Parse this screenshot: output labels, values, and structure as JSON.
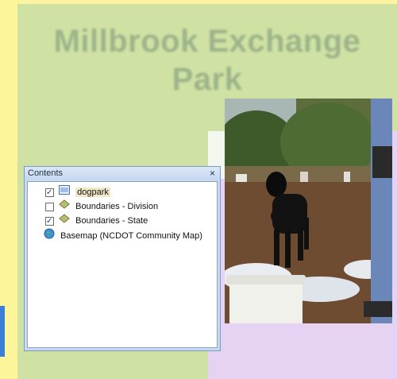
{
  "map": {
    "title": "Millbrook Exchange Park"
  },
  "contents_window": {
    "title": "Contents",
    "close_label": "×",
    "layers": [
      {
        "label": "dogpark",
        "checked": true,
        "icon": "raster-layer-icon",
        "selected": true
      },
      {
        "label": "Boundaries - Division",
        "checked": false,
        "icon": "polygon-layer-icon"
      },
      {
        "label": "Boundaries - State",
        "checked": true,
        "icon": "polygon-layer-icon"
      },
      {
        "label": "Basemap (NCDOT Community Map)",
        "icon": "globe-icon"
      }
    ]
  },
  "colors": {
    "background": "#fdf3a0",
    "map_fill": "#cfe2a3",
    "accent_panel": "#e6d2f3",
    "window_chrome": "#c9daf0"
  }
}
